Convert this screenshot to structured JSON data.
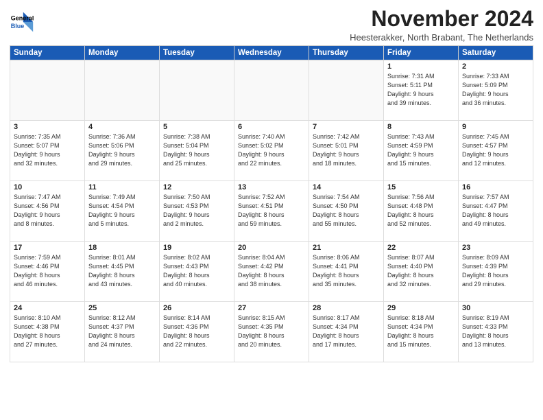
{
  "logo": {
    "line1": "General",
    "line2": "Blue"
  },
  "title": "November 2024",
  "subtitle": "Heesterakker, North Brabant, The Netherlands",
  "headers": [
    "Sunday",
    "Monday",
    "Tuesday",
    "Wednesday",
    "Thursday",
    "Friday",
    "Saturday"
  ],
  "weeks": [
    [
      {
        "day": "",
        "info": ""
      },
      {
        "day": "",
        "info": ""
      },
      {
        "day": "",
        "info": ""
      },
      {
        "day": "",
        "info": ""
      },
      {
        "day": "",
        "info": ""
      },
      {
        "day": "1",
        "info": "Sunrise: 7:31 AM\nSunset: 5:11 PM\nDaylight: 9 hours\nand 39 minutes."
      },
      {
        "day": "2",
        "info": "Sunrise: 7:33 AM\nSunset: 5:09 PM\nDaylight: 9 hours\nand 36 minutes."
      }
    ],
    [
      {
        "day": "3",
        "info": "Sunrise: 7:35 AM\nSunset: 5:07 PM\nDaylight: 9 hours\nand 32 minutes."
      },
      {
        "day": "4",
        "info": "Sunrise: 7:36 AM\nSunset: 5:06 PM\nDaylight: 9 hours\nand 29 minutes."
      },
      {
        "day": "5",
        "info": "Sunrise: 7:38 AM\nSunset: 5:04 PM\nDaylight: 9 hours\nand 25 minutes."
      },
      {
        "day": "6",
        "info": "Sunrise: 7:40 AM\nSunset: 5:02 PM\nDaylight: 9 hours\nand 22 minutes."
      },
      {
        "day": "7",
        "info": "Sunrise: 7:42 AM\nSunset: 5:01 PM\nDaylight: 9 hours\nand 18 minutes."
      },
      {
        "day": "8",
        "info": "Sunrise: 7:43 AM\nSunset: 4:59 PM\nDaylight: 9 hours\nand 15 minutes."
      },
      {
        "day": "9",
        "info": "Sunrise: 7:45 AM\nSunset: 4:57 PM\nDaylight: 9 hours\nand 12 minutes."
      }
    ],
    [
      {
        "day": "10",
        "info": "Sunrise: 7:47 AM\nSunset: 4:56 PM\nDaylight: 9 hours\nand 8 minutes."
      },
      {
        "day": "11",
        "info": "Sunrise: 7:49 AM\nSunset: 4:54 PM\nDaylight: 9 hours\nand 5 minutes."
      },
      {
        "day": "12",
        "info": "Sunrise: 7:50 AM\nSunset: 4:53 PM\nDaylight: 9 hours\nand 2 minutes."
      },
      {
        "day": "13",
        "info": "Sunrise: 7:52 AM\nSunset: 4:51 PM\nDaylight: 8 hours\nand 59 minutes."
      },
      {
        "day": "14",
        "info": "Sunrise: 7:54 AM\nSunset: 4:50 PM\nDaylight: 8 hours\nand 55 minutes."
      },
      {
        "day": "15",
        "info": "Sunrise: 7:56 AM\nSunset: 4:48 PM\nDaylight: 8 hours\nand 52 minutes."
      },
      {
        "day": "16",
        "info": "Sunrise: 7:57 AM\nSunset: 4:47 PM\nDaylight: 8 hours\nand 49 minutes."
      }
    ],
    [
      {
        "day": "17",
        "info": "Sunrise: 7:59 AM\nSunset: 4:46 PM\nDaylight: 8 hours\nand 46 minutes."
      },
      {
        "day": "18",
        "info": "Sunrise: 8:01 AM\nSunset: 4:45 PM\nDaylight: 8 hours\nand 43 minutes."
      },
      {
        "day": "19",
        "info": "Sunrise: 8:02 AM\nSunset: 4:43 PM\nDaylight: 8 hours\nand 40 minutes."
      },
      {
        "day": "20",
        "info": "Sunrise: 8:04 AM\nSunset: 4:42 PM\nDaylight: 8 hours\nand 38 minutes."
      },
      {
        "day": "21",
        "info": "Sunrise: 8:06 AM\nSunset: 4:41 PM\nDaylight: 8 hours\nand 35 minutes."
      },
      {
        "day": "22",
        "info": "Sunrise: 8:07 AM\nSunset: 4:40 PM\nDaylight: 8 hours\nand 32 minutes."
      },
      {
        "day": "23",
        "info": "Sunrise: 8:09 AM\nSunset: 4:39 PM\nDaylight: 8 hours\nand 29 minutes."
      }
    ],
    [
      {
        "day": "24",
        "info": "Sunrise: 8:10 AM\nSunset: 4:38 PM\nDaylight: 8 hours\nand 27 minutes."
      },
      {
        "day": "25",
        "info": "Sunrise: 8:12 AM\nSunset: 4:37 PM\nDaylight: 8 hours\nand 24 minutes."
      },
      {
        "day": "26",
        "info": "Sunrise: 8:14 AM\nSunset: 4:36 PM\nDaylight: 8 hours\nand 22 minutes."
      },
      {
        "day": "27",
        "info": "Sunrise: 8:15 AM\nSunset: 4:35 PM\nDaylight: 8 hours\nand 20 minutes."
      },
      {
        "day": "28",
        "info": "Sunrise: 8:17 AM\nSunset: 4:34 PM\nDaylight: 8 hours\nand 17 minutes."
      },
      {
        "day": "29",
        "info": "Sunrise: 8:18 AM\nSunset: 4:34 PM\nDaylight: 8 hours\nand 15 minutes."
      },
      {
        "day": "30",
        "info": "Sunrise: 8:19 AM\nSunset: 4:33 PM\nDaylight: 8 hours\nand 13 minutes."
      }
    ]
  ]
}
